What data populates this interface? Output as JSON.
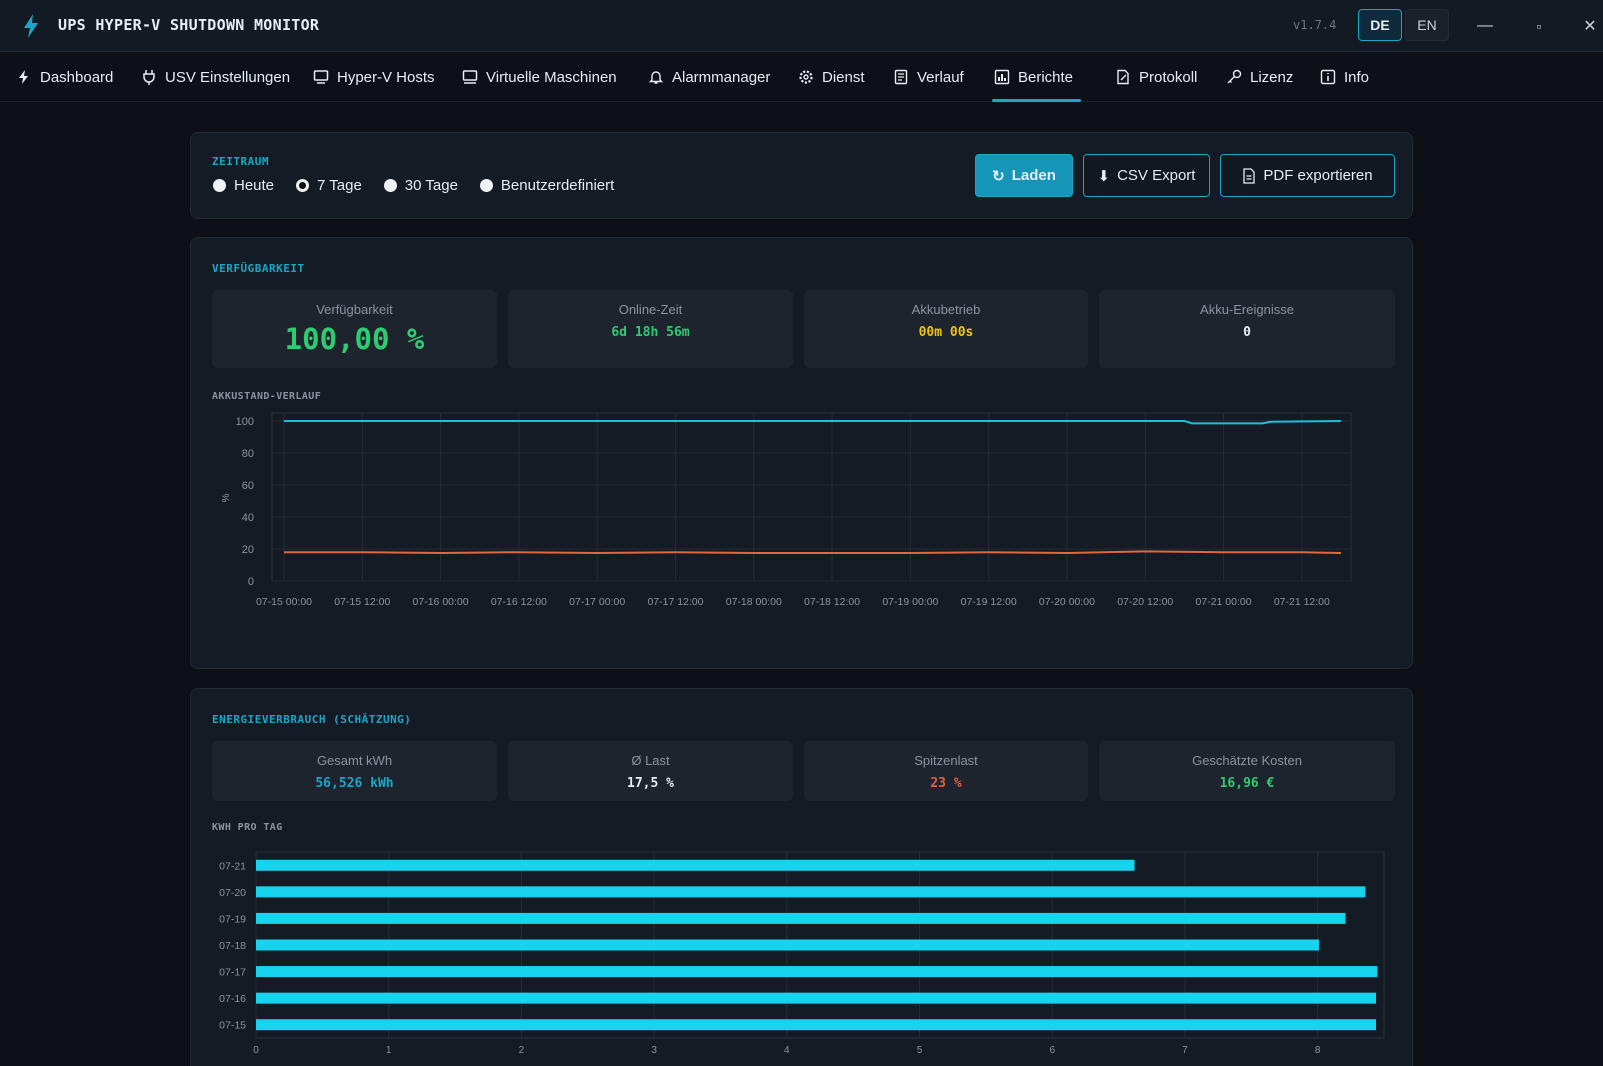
{
  "app": {
    "title": "UPS HYPER-V SHUTDOWN MONITOR",
    "version": "v1.7.4",
    "lang_de": "DE",
    "lang_en": "EN",
    "accent": "#1aa7c7"
  },
  "window_controls": {
    "minimize": "—",
    "maximize": "▫",
    "close": "✕"
  },
  "nav": [
    {
      "label": "Dashboard",
      "icon": "bolt-icon"
    },
    {
      "label": "USV Einstellungen",
      "icon": "plug-icon"
    },
    {
      "label": "Hyper-V Hosts",
      "icon": "server-icon"
    },
    {
      "label": "Virtuelle Maschinen",
      "icon": "monitor-icon"
    },
    {
      "label": "Alarmmanager",
      "icon": "bell-icon"
    },
    {
      "label": "Dienst",
      "icon": "gear-icon"
    },
    {
      "label": "Verlauf",
      "icon": "list-icon"
    },
    {
      "label": "Berichte",
      "icon": "chart-icon",
      "active": true
    },
    {
      "label": "Protokoll",
      "icon": "file-edit-icon"
    },
    {
      "label": "Lizenz",
      "icon": "key-icon"
    },
    {
      "label": "Info",
      "icon": "info-icon"
    }
  ],
  "period": {
    "label": "ZEITRAUM",
    "options": [
      "Heute",
      "7 Tage",
      "30 Tage",
      "Benutzerdefiniert"
    ],
    "selected": "7 Tage",
    "load": "Laden",
    "csv": "CSV Export",
    "pdf": "PDF exportieren"
  },
  "availability": {
    "label": "VERFÜGBARKEIT",
    "stats": [
      {
        "label": "Verfügbarkeit",
        "value": "100,00 %",
        "color": "#2ecc71"
      },
      {
        "label": "Online-Zeit",
        "value": "6d 18h 56m",
        "color": "#2ecc71"
      },
      {
        "label": "Akkubetrieb",
        "value": "00m 00s",
        "color": "#f1c40f"
      },
      {
        "label": "Akku-Ereignisse",
        "value": "0",
        "color": "#e6edf3"
      }
    ],
    "chart_label": "AKKUSTAND-VERLAUF"
  },
  "energy": {
    "label": "ENERGIEVERBRAUCH (SCHÄTZUNG)",
    "stats": [
      {
        "label": "Gesamt kWh",
        "value": "56,526 kWh",
        "color": "#1aa7c7"
      },
      {
        "label": "Ø Last",
        "value": "17,5 %",
        "color": "#e6edf3"
      },
      {
        "label": "Spitzenlast",
        "value": "23 %",
        "color": "#e85d3f"
      },
      {
        "label": "Geschätzte Kosten",
        "value": "16,96 €",
        "color": "#2ecc71"
      }
    ],
    "chart_label": "KWH PRO TAG"
  },
  "chart_data": [
    {
      "type": "line",
      "ylabel": "%",
      "ylim": [
        0,
        100
      ],
      "yticks": [
        0,
        20,
        40,
        60,
        80,
        100
      ],
      "xticks": [
        "07-15 00:00",
        "07-15 12:00",
        "07-16 00:00",
        "07-16 12:00",
        "07-17 00:00",
        "07-17 12:00",
        "07-18 00:00",
        "07-18 12:00",
        "07-19 00:00",
        "07-19 12:00",
        "07-20 00:00",
        "07-20 12:00",
        "07-21 00:00",
        "07-21 12:00"
      ],
      "grid": true,
      "series": [
        {
          "color": "#17c3dc",
          "points": [
            [
              0,
              100
            ],
            [
              11.5,
              100
            ],
            [
              11.6,
              98.5
            ],
            [
              12.5,
              98.5
            ],
            [
              12.6,
              99.5
            ],
            [
              13.5,
              100
            ]
          ]
        },
        {
          "color": "#e0673f",
          "points": [
            [
              0,
              18
            ],
            [
              1,
              18
            ],
            [
              2,
              17.5
            ],
            [
              3,
              18
            ],
            [
              4,
              17.5
            ],
            [
              5,
              18
            ],
            [
              6,
              17.5
            ],
            [
              7,
              17.5
            ],
            [
              8,
              17.5
            ],
            [
              9,
              18
            ],
            [
              10,
              17.5
            ],
            [
              11,
              18.5
            ],
            [
              12,
              18
            ],
            [
              13,
              18
            ],
            [
              13.5,
              17.5
            ]
          ]
        }
      ]
    },
    {
      "type": "bar",
      "orientation": "horizontal",
      "categories": [
        "07-21",
        "07-20",
        "07-19",
        "07-18",
        "07-17",
        "07-16",
        "07-15"
      ],
      "values": [
        6.62,
        8.36,
        8.21,
        8.01,
        8.45,
        8.44,
        8.44
      ],
      "xlim": [
        0,
        8.5
      ],
      "xticks": [
        0,
        1,
        2,
        3,
        4,
        5,
        6,
        7,
        8
      ],
      "grid": true,
      "color": "#17d3ee"
    }
  ]
}
